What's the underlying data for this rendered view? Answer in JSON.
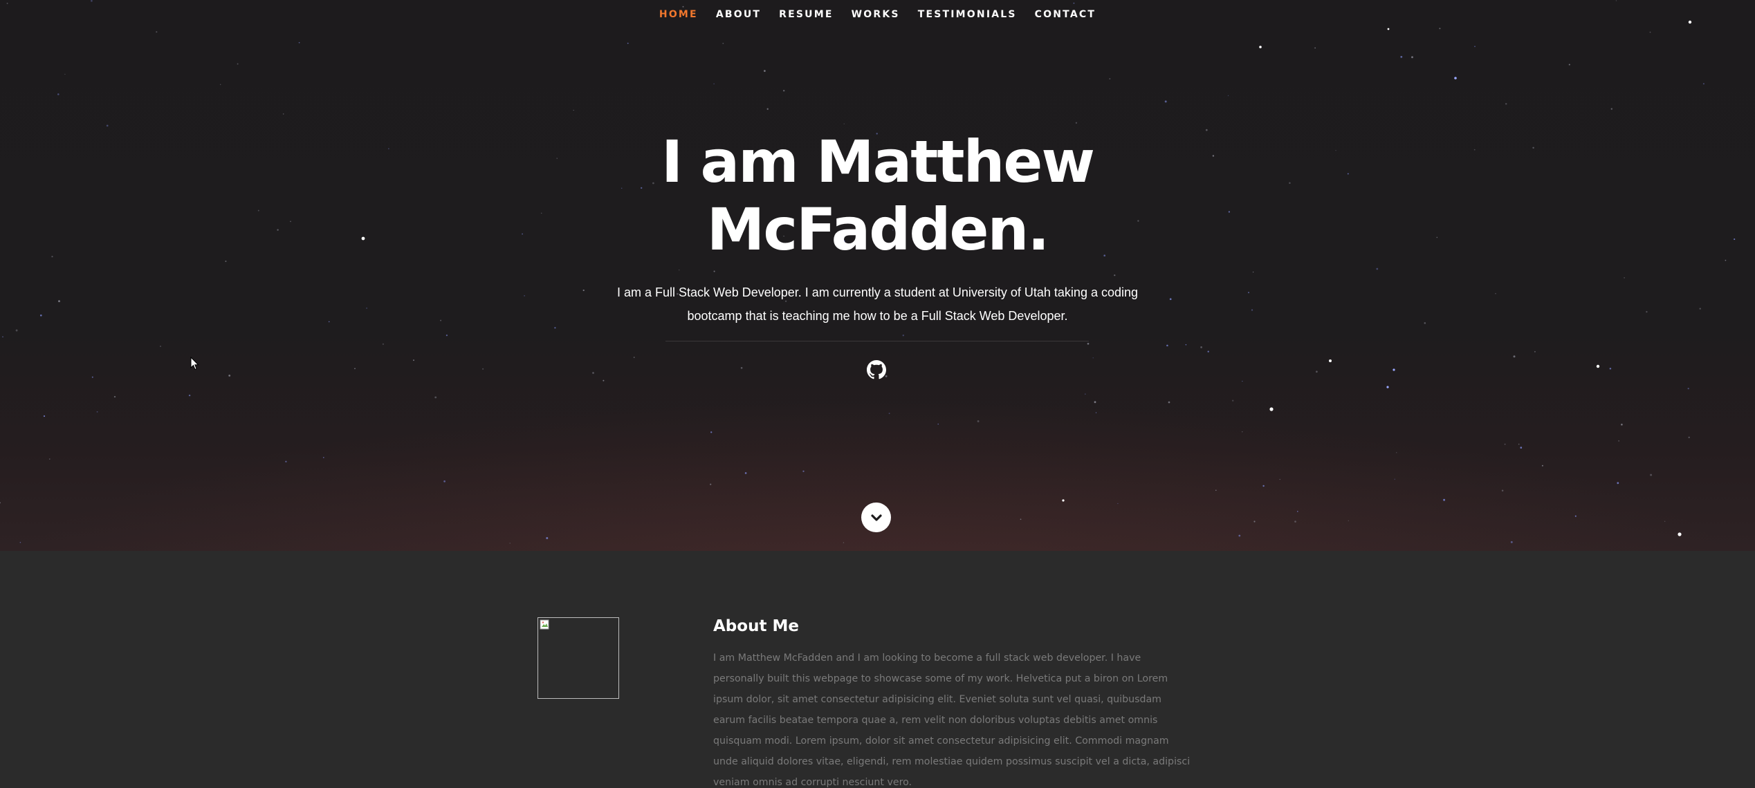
{
  "nav": {
    "items": [
      {
        "label": "HOME"
      },
      {
        "label": "ABOUT"
      },
      {
        "label": "RESUME"
      },
      {
        "label": "WORKS"
      },
      {
        "label": "TESTIMONIALS"
      },
      {
        "label": "CONTACT"
      }
    ],
    "current": "HOME"
  },
  "hero": {
    "headline_line1": "I am Matthew",
    "headline_line2": "McFadden.",
    "intro": "I am a Full Stack Web Developer. I am currently a student at University of Utah taking a coding bootcamp that is teaching me how to be a Full Stack Web Developer.",
    "social_icon": "github-icon",
    "scroll_icon": "chevron-down-icon"
  },
  "about": {
    "title": "About Me",
    "text": "I am Matthew McFadden and I am looking to become a full stack web developer. I have personally built this webpage to showcase some of my work. Helvetica put a biron on Lorem ipsum dolor, sit amet consectetur adipisicing elit. Eveniet soluta sunt vel quasi, quibusdam earum facilis beatae tempora quae a, rem velit non doloribus voluptas debitis amet omnis quisquam modi. Lorem ipsum, dolor sit amet consectetur adipisicing elit. Commodi magnam unde aliquid dolores vitae, eligendi, rem molestiae quidem possimus suscipit vel a dicta, adipisci veniam omnis ad corrupti nesciunt vero.",
    "image": "broken-image-icon"
  },
  "colors": {
    "accent": "#f0772d",
    "hero_bg": "#1d1b1d",
    "about_bg": "#2b2b2b",
    "about_text": "#7a7a7a"
  }
}
